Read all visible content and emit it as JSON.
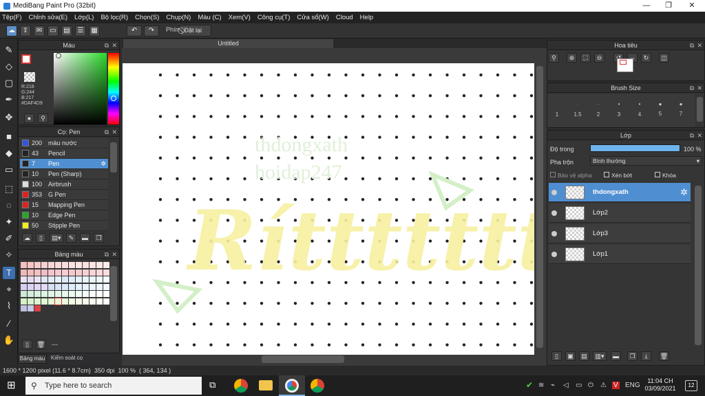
{
  "window": {
    "title": "MediBang Paint Pro (32bit)"
  },
  "menu": [
    "Tệp(F)",
    "Chỉnh sửa(E)",
    "Lớp(L)",
    "Bộ lọc(R)",
    "Chọn(S)",
    "Chụp(N)",
    "Màu (C)",
    "Xem(V)",
    "Công cụ(T)",
    "Cửa sổ(W)",
    "Cloud",
    "Help"
  ],
  "toolbar": {
    "snap_label": "Phím",
    "reset_label": "Đặt lại"
  },
  "color_panel": {
    "title": "Màu",
    "r": "R:218",
    "g": "G:244",
    "b": "B:217",
    "hex": "#DAF4D9",
    "hue_color": "#2bd92b"
  },
  "brush_panel": {
    "title": "Cọ: Pen",
    "items": [
      {
        "size": "200",
        "name": "màu nước",
        "color": "#3355dd"
      },
      {
        "size": "43",
        "name": "Pencil",
        "color": "#222222"
      },
      {
        "size": "7",
        "name": "Pen",
        "color": "#222222"
      },
      {
        "size": "10",
        "name": "Pen (Sharp)",
        "color": "#222222"
      },
      {
        "size": "100",
        "name": "Airbrush",
        "color": "#dddddd"
      },
      {
        "size": "353",
        "name": "G Pen",
        "color": "#dd2222"
      },
      {
        "size": "15",
        "name": "Mapping Pen",
        "color": "#dd2222"
      },
      {
        "size": "10",
        "name": "Edge Pen",
        "color": "#22aa22"
      },
      {
        "size": "50",
        "name": "Stipple Pen",
        "color": "#eeee22"
      }
    ]
  },
  "palette_panel": {
    "title": "Bảng màu",
    "footer": "---",
    "tabs": [
      "Bảng màu",
      "Kiểm soát cọ"
    ]
  },
  "canvas": {
    "tab_title": "Untitled",
    "watermark1": "thdongxath",
    "watermark2": "hoidap247",
    "lettering": "Ríttttttt"
  },
  "navigator": {
    "title": "Hoa tiêu"
  },
  "brush_size": {
    "title": "Brush Size",
    "sizes": [
      "1",
      "1.5",
      "2",
      "3",
      "4",
      "5",
      "7"
    ]
  },
  "layers": {
    "title": "Lớp",
    "opacity_label": "Độ trong",
    "opacity_value": "100 %",
    "opacity": 1.0,
    "blend_label": "Pha trộn",
    "blend_value": "Bình thường",
    "protect_alpha": "Bảo vệ alpha",
    "clipping": "Xén bớt",
    "lock": "Khóa",
    "items": [
      {
        "name": "thdongxath"
      },
      {
        "name": "Lớp2"
      },
      {
        "name": "Lớp3"
      },
      {
        "name": "Lớp1"
      }
    ]
  },
  "status": {
    "size": "1600 * 1200 pixel",
    "cm": "(11.6 * 8.7cm)",
    "dpi": "350 dpi",
    "zoom": "100 %",
    "coords": "( 364, 134 )"
  },
  "taskbar": {
    "search_placeholder": "Type here to search",
    "lang": "ENG",
    "time": "11:04 CH",
    "date": "03/09/2021",
    "notif_count": "12"
  }
}
